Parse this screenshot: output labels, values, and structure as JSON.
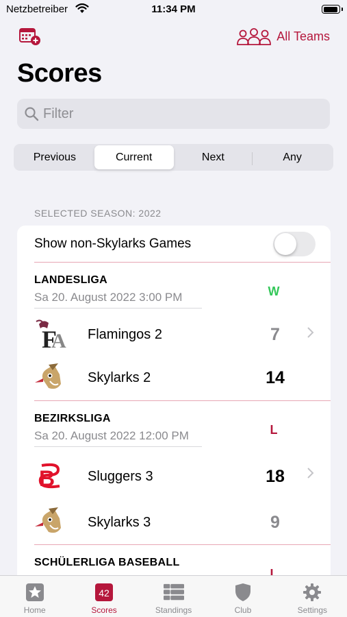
{
  "status": {
    "carrier": "Netzbetreiber",
    "time": "11:34 PM",
    "battery_level": 0.95
  },
  "header": {
    "all_teams_label": "All Teams",
    "title": "Scores"
  },
  "search": {
    "placeholder": "Filter",
    "value": ""
  },
  "segments": {
    "items": [
      "Previous",
      "Current",
      "Next",
      "Any"
    ],
    "selected": "Current"
  },
  "season_label": "SELECTED SEASON: 2022",
  "toggle": {
    "label": "Show non-Skylarks Games",
    "on": false
  },
  "games": [
    {
      "league": "LANDESLIGA",
      "date": "Sa  20. August 2022  3:00 PM",
      "result": "W",
      "away": {
        "team": "Flamingos 2",
        "score": "7",
        "logo": "flamingos-logo"
      },
      "home": {
        "team": "Skylarks 2",
        "score": "14",
        "logo": "skylarks-logo"
      }
    },
    {
      "league": "BEZIRKSLIGA",
      "date": "Sa  20. August 2022  12:00 PM",
      "result": "L",
      "away": {
        "team": "Sluggers 3",
        "score": "18",
        "logo": "sluggers-logo"
      },
      "home": {
        "team": "Skylarks 3",
        "score": "9",
        "logo": "skylarks-logo"
      }
    },
    {
      "league": "SCHÜLERLIGA BASEBALL",
      "result": "L"
    }
  ],
  "tabs": [
    {
      "label": "Home",
      "icon": "star-icon"
    },
    {
      "label": "Scores",
      "icon": "calendar-badge-icon",
      "badge": "42"
    },
    {
      "label": "Standings",
      "icon": "table-icon"
    },
    {
      "label": "Club",
      "icon": "shield-icon"
    },
    {
      "label": "Settings",
      "icon": "gear-icon"
    }
  ],
  "colors": {
    "accent": "#b5173c",
    "win": "#34c759",
    "background": "#f2f2f7"
  }
}
